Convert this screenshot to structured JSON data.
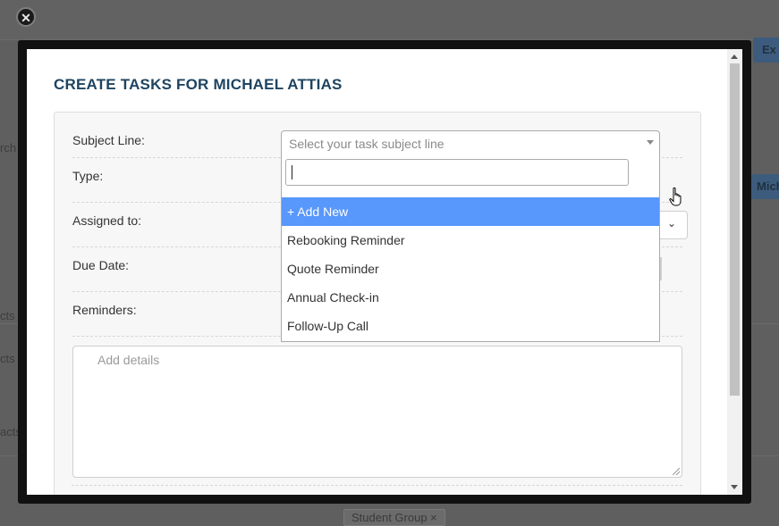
{
  "modal": {
    "title": "CREATE TASKS FOR MICHAEL ATTIAS",
    "close_glyph": "✕"
  },
  "form": {
    "subject_label": "Subject Line:",
    "type_label": "Type:",
    "assigned_label": "Assigned to:",
    "due_label": "Due Date:",
    "reminders_label": "Reminders:",
    "details_placeholder": "Add details",
    "subject_placeholder": "Select your task subject line",
    "search_value": ""
  },
  "dropdown": {
    "options": [
      "+ Add New",
      "Rebooking Reminder",
      "Quote Reminder",
      "Annual Check-in",
      "Follow-Up Call"
    ],
    "active_index": 0
  },
  "background": {
    "top_button": "Ex",
    "side_button": "Mich",
    "left_snippets": [
      "rch",
      "cts",
      "cts",
      "acts"
    ],
    "bottom_tag": "Student Group ×"
  },
  "colors": {
    "title": "#1e4461",
    "active_option": "#5897fb"
  },
  "icons": {
    "close": "close-icon",
    "dropdown_arrow": "chevron-down-icon",
    "cursor": "hand-pointer-icon"
  }
}
